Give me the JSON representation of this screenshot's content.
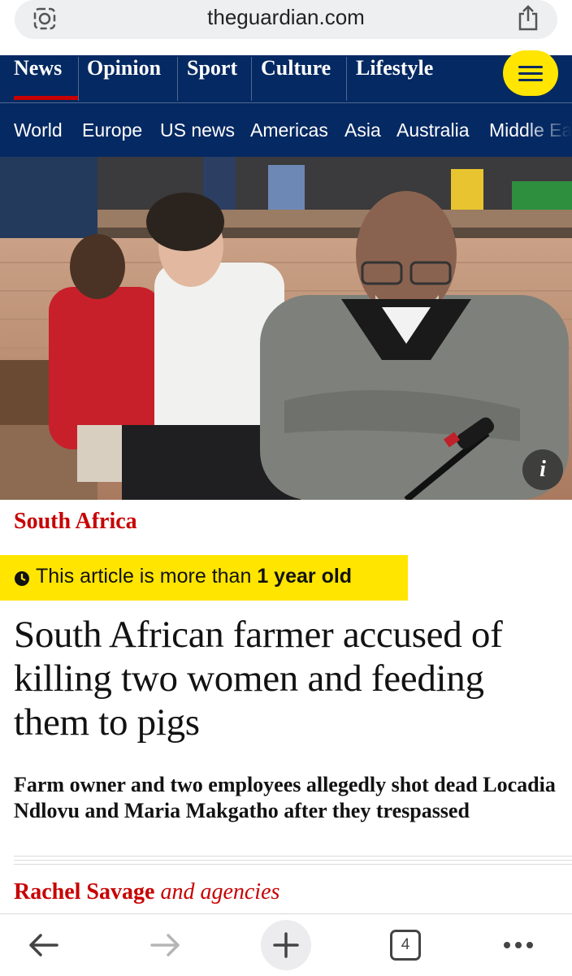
{
  "browser": {
    "url": "theguardian.com",
    "tab_count": "4"
  },
  "nav": {
    "pillars": [
      "News",
      "Opinion",
      "Sport",
      "Culture",
      "Lifestyle"
    ],
    "subnav": [
      "World",
      "Europe",
      "US news",
      "Americas",
      "Asia",
      "Australia",
      "Middle East"
    ]
  },
  "image": {
    "info_label": "i"
  },
  "article": {
    "section": "South Africa",
    "age_prefix": "This article is more than ",
    "age_bold": "1 year old",
    "headline": "South African farmer accused of killing two women and feeding them to pigs",
    "standfirst": "Farm owner and two employees allegedly shot dead Locadia Ndlovu and Maria Makgatho after they trespassed",
    "byline_author": "Rachel Savage",
    "byline_suffix": "and agencies"
  },
  "colors": {
    "guardian_blue": "#052962",
    "news_red": "#c70000",
    "highlight_yellow": "#ffe500"
  },
  "icons": {
    "url_left": "site-settings-icon",
    "url_right": "share-icon",
    "menu": "hamburger-menu-icon",
    "toolbar": [
      "back-arrow-icon",
      "forward-arrow-icon",
      "new-tab-plus-icon",
      "tab-switcher-icon",
      "more-options-icon"
    ]
  }
}
